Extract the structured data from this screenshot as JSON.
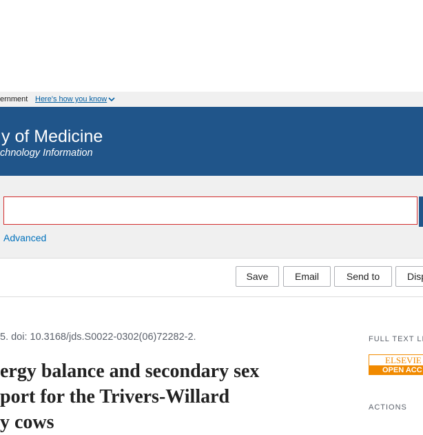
{
  "gov_banner": {
    "text": "ernment",
    "link": "Here's how you know"
  },
  "header": {
    "title": "y of Medicine",
    "subtitle": "chnology Information"
  },
  "search": {
    "value": "",
    "placeholder": "",
    "advanced_label": "Advanced"
  },
  "toolbar": {
    "save_label": "Save",
    "email_label": "Email",
    "send_to_label": "Send to",
    "display_label": "Disp"
  },
  "article": {
    "citation": "5. doi: 10.3168/jds.S0022-0302(06)72282-2.",
    "title_lines": [
      "ergy balance and secondary sex",
      "port for the Trivers-Willard",
      "y cows"
    ]
  },
  "sidebar": {
    "full_text_heading": "FULL TEXT LIN",
    "elsevier_top": "ELSEVIE",
    "elsevier_bottom": "OPEN ACC",
    "actions_heading": "ACTIONS"
  },
  "colors": {
    "header_bg": "#20558a",
    "banner_bg": "#f0f0f0",
    "search_border": "#d12b2b",
    "link": "#0071bc",
    "elsevier_orange": "#f18a00"
  }
}
